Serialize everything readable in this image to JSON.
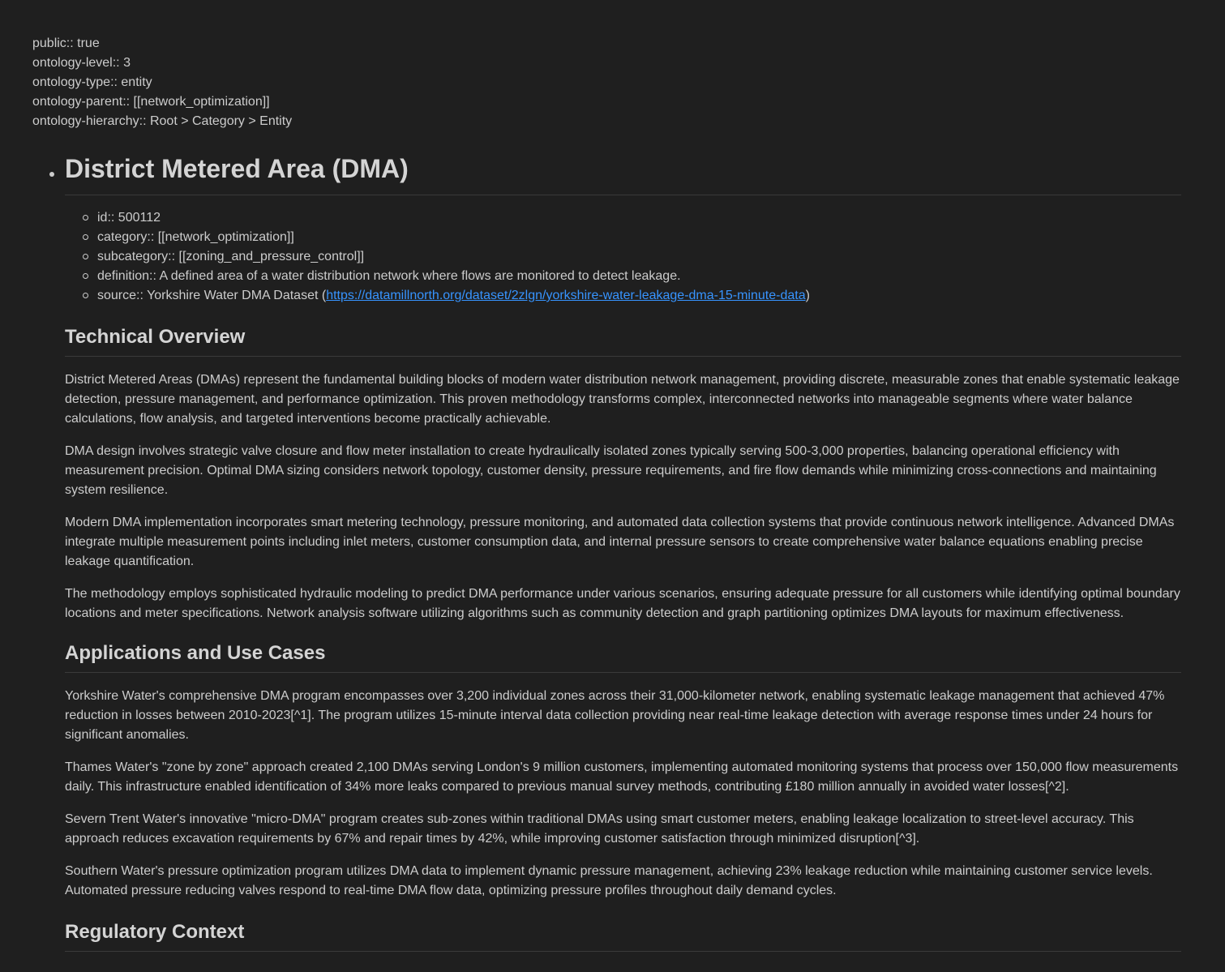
{
  "properties": [
    "public:: true",
    "ontology-level:: 3",
    "ontology-type:: entity",
    "ontology-parent:: [[network_optimization]]",
    "ontology-hierarchy:: Root > Category > Entity"
  ],
  "title": "District Metered Area (DMA)",
  "meta": {
    "id": "id:: 500112",
    "category": "category:: [[network_optimization]]",
    "subcategory": "subcategory:: [[zoning_and_pressure_control]]",
    "definition": "definition:: A defined area of a water distribution network where flows are monitored to detect leakage.",
    "source_prefix": "source:: Yorkshire Water DMA Dataset (",
    "source_link": "https://datamillnorth.org/dataset/2zlgn/yorkshire-water-leakage-dma-15-minute-data",
    "source_suffix": ")"
  },
  "sections": [
    {
      "heading": "Technical Overview",
      "paragraphs": [
        "District Metered Areas (DMAs) represent the fundamental building blocks of modern water distribution network management, providing discrete, measurable zones that enable systematic leakage detection, pressure management, and performance optimization. This proven methodology transforms complex, interconnected networks into manageable segments where water balance calculations, flow analysis, and targeted interventions become practically achievable.",
        "DMA design involves strategic valve closure and flow meter installation to create hydraulically isolated zones typically serving 500-3,000 properties, balancing operational efficiency with measurement precision. Optimal DMA sizing considers network topology, customer density, pressure requirements, and fire flow demands while minimizing cross-connections and maintaining system resilience.",
        "Modern DMA implementation incorporates smart metering technology, pressure monitoring, and automated data collection systems that provide continuous network intelligence. Advanced DMAs integrate multiple measurement points including inlet meters, customer consumption data, and internal pressure sensors to create comprehensive water balance equations enabling precise leakage quantification.",
        "The methodology employs sophisticated hydraulic modeling to predict DMA performance under various scenarios, ensuring adequate pressure for all customers while identifying optimal boundary locations and meter specifications. Network analysis software utilizing algorithms such as community detection and graph partitioning optimizes DMA layouts for maximum effectiveness."
      ]
    },
    {
      "heading": "Applications and Use Cases",
      "paragraphs": [
        "Yorkshire Water's comprehensive DMA program encompasses over 3,200 individual zones across their 31,000-kilometer network, enabling systematic leakage management that achieved 47% reduction in losses between 2010-2023[^1]. The program utilizes 15-minute interval data collection providing near real-time leakage detection with average response times under 24 hours for significant anomalies.",
        "Thames Water's \"zone by zone\" approach created 2,100 DMAs serving London's 9 million customers, implementing automated monitoring systems that process over 150,000 flow measurements daily. This infrastructure enabled identification of 34% more leaks compared to previous manual survey methods, contributing £180 million annually in avoided water losses[^2].",
        "Severn Trent Water's innovative \"micro-DMA\" program creates sub-zones within traditional DMAs using smart customer meters, enabling leakage localization to street-level accuracy. This approach reduces excavation requirements by 67% and repair times by 42%, while improving customer satisfaction through minimized disruption[^3].",
        "Southern Water's pressure optimization program utilizes DMA data to implement dynamic pressure management, achieving 23% leakage reduction while maintaining customer service levels. Automated pressure reducing valves respond to real-time DMA flow data, optimizing pressure profiles throughout daily demand cycles."
      ]
    },
    {
      "heading": "Regulatory Context",
      "paragraphs": []
    }
  ],
  "colors": {
    "background": "#1f1f1f",
    "text": "#cccccc",
    "heading": "#d4d4d4",
    "link": "#3794ff",
    "rule": "#3a3a3a"
  }
}
